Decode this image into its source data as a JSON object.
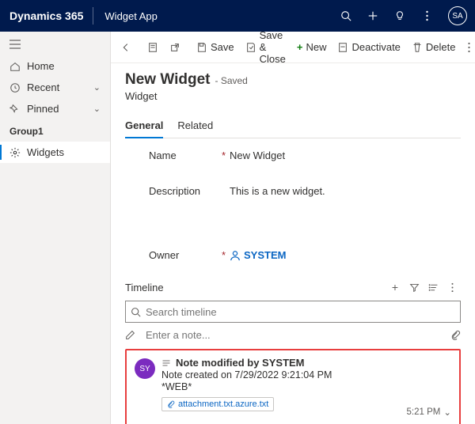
{
  "topbar": {
    "brand": "Dynamics 365",
    "app": "Widget App",
    "avatar": "SA"
  },
  "sidebar": {
    "home": "Home",
    "recent": "Recent",
    "pinned": "Pinned",
    "group": "Group1",
    "widgets": "Widgets"
  },
  "commands": {
    "save": "Save",
    "save_close": "Save & Close",
    "new": "New",
    "deactivate": "Deactivate",
    "delete": "Delete"
  },
  "record": {
    "title": "New Widget",
    "saved": "- Saved",
    "entity": "Widget"
  },
  "tabs": {
    "general": "General",
    "related": "Related"
  },
  "fields": {
    "name_label": "Name",
    "name_value": "New Widget",
    "desc_label": "Description",
    "desc_value": "This is a new widget.",
    "owner_label": "Owner",
    "owner_value": "SYSTEM"
  },
  "timeline": {
    "title": "Timeline",
    "search_placeholder": "Search timeline",
    "note_placeholder": "Enter a note..."
  },
  "note": {
    "avatar": "SY",
    "title": "Note modified by SYSTEM",
    "created": "Note created on 7/29/2022 9:21:04 PM",
    "tag": "*WEB*",
    "attachment": "attachment.txt.azure.txt",
    "time": "5:21 PM"
  }
}
